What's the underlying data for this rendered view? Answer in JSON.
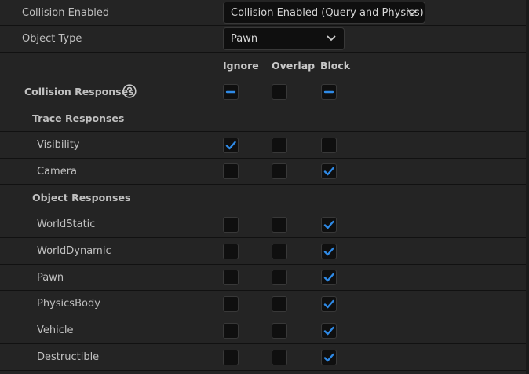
{
  "collision_enabled": {
    "label": "Collision Enabled",
    "value": "Collision Enabled (Query and Physics)"
  },
  "object_type": {
    "label": "Object Type",
    "value": "Pawn"
  },
  "columns": {
    "ignore": "Ignore",
    "overlap": "Overlap",
    "block": "Block"
  },
  "collision_responses": {
    "label": "Collision Responses",
    "state": [
      "mixed",
      "unchecked",
      "mixed"
    ]
  },
  "trace_responses": {
    "label": "Trace Responses",
    "rows": [
      {
        "label": "Visibility",
        "state": [
          "checked",
          "unchecked",
          "unchecked"
        ]
      },
      {
        "label": "Camera",
        "state": [
          "unchecked",
          "unchecked",
          "checked"
        ]
      }
    ]
  },
  "object_responses": {
    "label": "Object Responses",
    "rows": [
      {
        "label": "WorldStatic",
        "state": [
          "unchecked",
          "unchecked",
          "checked"
        ]
      },
      {
        "label": "WorldDynamic",
        "state": [
          "unchecked",
          "unchecked",
          "checked"
        ]
      },
      {
        "label": "Pawn",
        "state": [
          "unchecked",
          "unchecked",
          "checked"
        ]
      },
      {
        "label": "PhysicsBody",
        "state": [
          "unchecked",
          "unchecked",
          "checked"
        ]
      },
      {
        "label": "Vehicle",
        "state": [
          "unchecked",
          "unchecked",
          "checked"
        ]
      },
      {
        "label": "Destructible",
        "state": [
          "unchecked",
          "unchecked",
          "checked"
        ]
      }
    ]
  },
  "colors": {
    "accent": "#2f8ae6",
    "background": "#242424",
    "field": "#0f0f0f"
  }
}
